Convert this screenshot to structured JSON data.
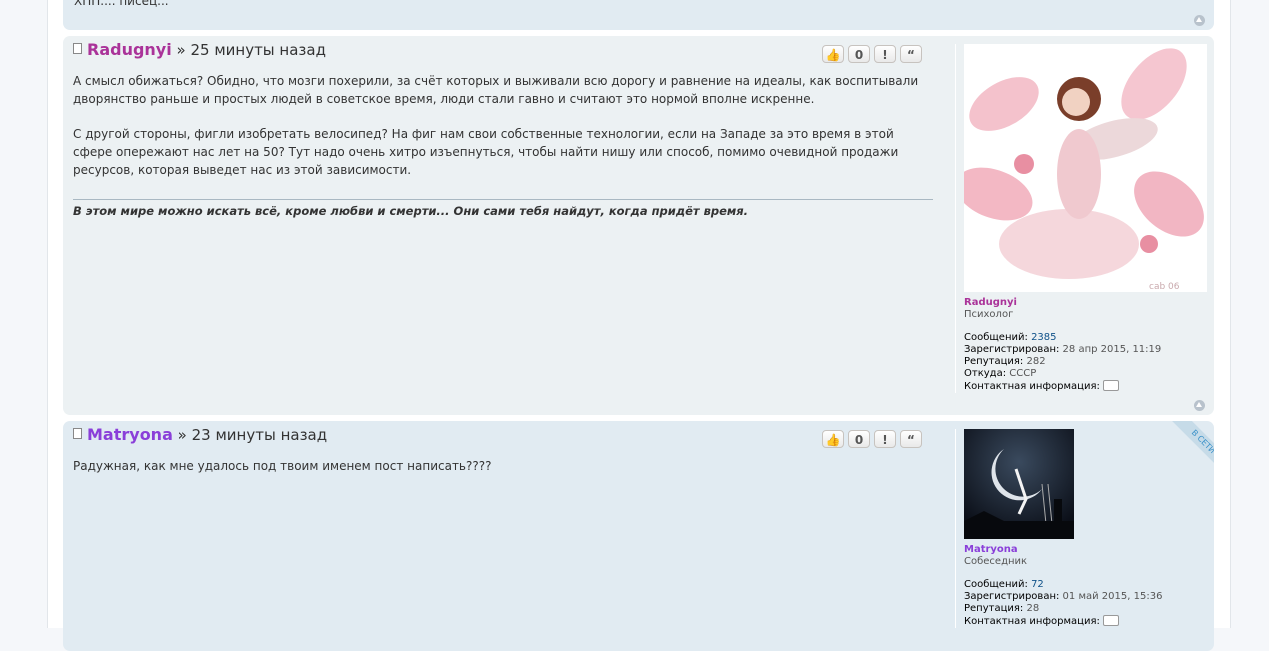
{
  "prev_post": {
    "text": "ХПП.... писец..."
  },
  "posts": [
    {
      "author": "Radugnyi",
      "author_color": "#AA3399",
      "separator": "»",
      "time": "25 минуты назад",
      "buttons": [
        "👍",
        "0",
        "!",
        "“"
      ],
      "paragraphs": [
        "А смысл обижаться? Обидно, что мозги похерили, за счёт которых и выживали всю дорогу и равнение на идеалы, как воспитывали дворянство раньше и простых людей в советское время, люди стали гавно и считают это нормой вполне искренне.",
        "С другой стороны, фигли изобретать велосипед? На фиг нам свои собственные технологии, если на Западе за это время в этой сфере опережают нас лет на 50? Тут надо очень хитро изъепнуться, чтобы найти нишу или способ, помимо очевидной продажи ресурсов, которая выведет нас из этой зависимости."
      ],
      "signature": "В этом мире можно искать всё, кроме любви и смерти... Они сами тебя найдут, когда придёт время.",
      "avatar_watermark": "cab 06",
      "profile": {
        "username": "Radugnyi",
        "rank": "Психолог",
        "posts_label": "Сообщений:",
        "posts_value": "2385",
        "reg_label": "Зарегистрирован:",
        "reg_value": "28 апр 2015, 11:19",
        "rep_label": "Репутация:",
        "rep_value": "282",
        "from_label": "Откуда:",
        "from_value": "СССР",
        "contact_label": "Контактная информация:"
      }
    },
    {
      "author": "Matryona",
      "author_color": "#8A3FD9",
      "separator": "»",
      "time": "23 минуты назад",
      "buttons": [
        "👍",
        "0",
        "!",
        "“"
      ],
      "paragraphs": [
        "Радужная, как мне удалось под твоим именем пост написать????"
      ],
      "online_badge": "В СЕТИ",
      "profile": {
        "username": "Matryona",
        "rank": "Собеседник",
        "posts_label": "Сообщений:",
        "posts_value": "72",
        "reg_label": "Зарегистрирован:",
        "reg_value": "01 май 2015, 15:36",
        "rep_label": "Репутация:",
        "rep_value": "28",
        "contact_label": "Контактная информация:"
      }
    }
  ],
  "colors": {
    "post_bg_1": "#ECF1F3",
    "post_bg_2": "#E1EBF2",
    "link": "#105289"
  }
}
